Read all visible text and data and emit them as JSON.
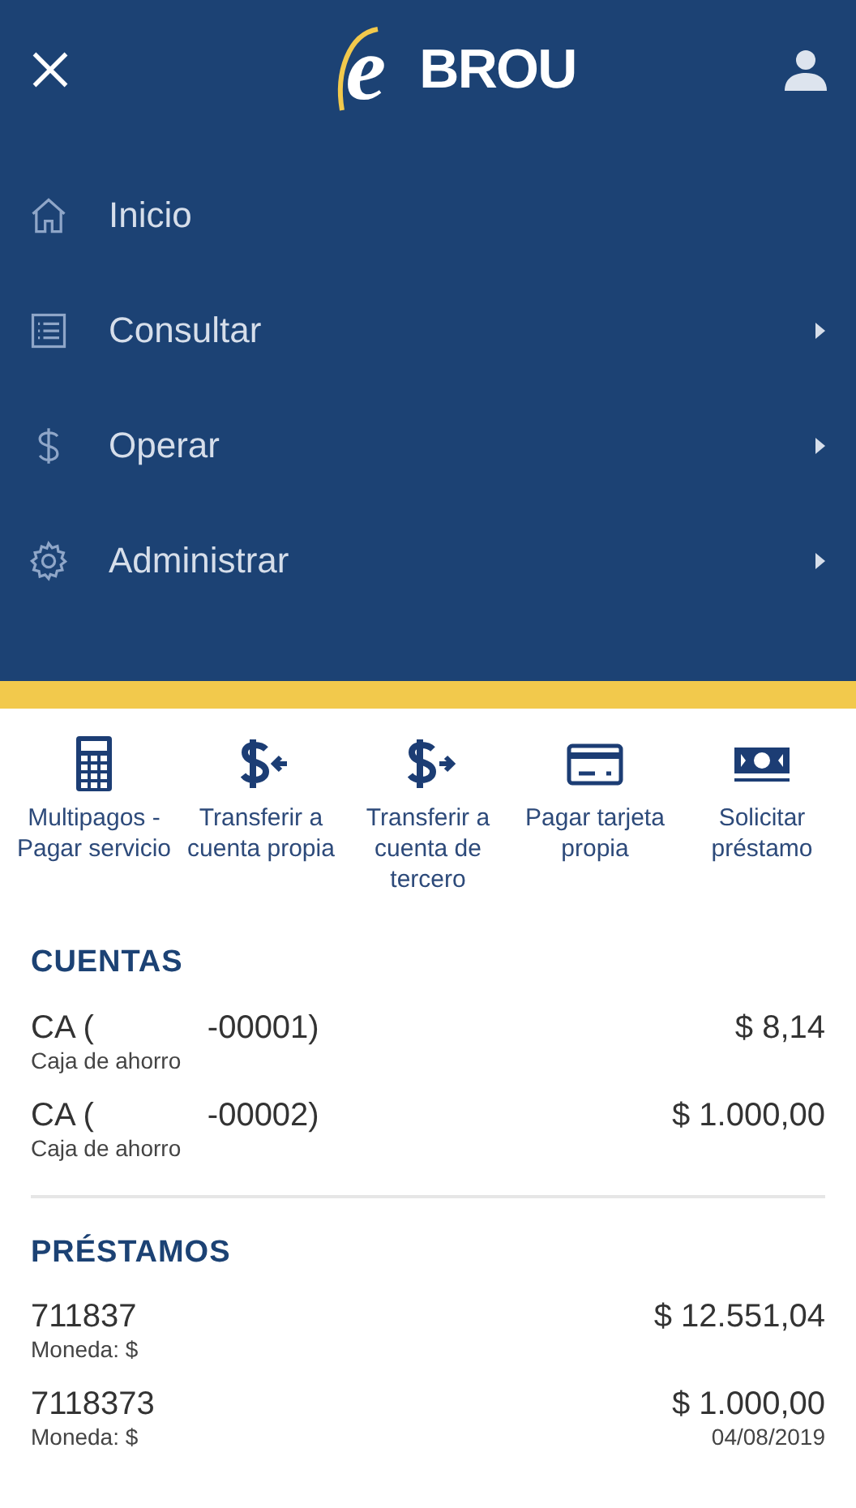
{
  "header": {
    "logo_letter": "e",
    "logo_text": "BROU"
  },
  "menu": [
    {
      "label": "Inicio",
      "has_submenu": false
    },
    {
      "label": "Consultar",
      "has_submenu": true
    },
    {
      "label": "Operar",
      "has_submenu": true
    },
    {
      "label": "Administrar",
      "has_submenu": true
    }
  ],
  "quick_actions": [
    {
      "label": "Multipagos - Pagar servicio"
    },
    {
      "label": "Transferir a cuenta propia"
    },
    {
      "label": "Transferir a cuenta de tercero"
    },
    {
      "label": "Pagar tarjeta propia"
    },
    {
      "label": "Solicitar préstamo"
    }
  ],
  "accounts": {
    "title": "CUENTAS",
    "items": [
      {
        "name_start": "CA (",
        "name_end": "-00001)",
        "type": "Caja de ahorro",
        "balance": "$ 8,14"
      },
      {
        "name_start": "CA (",
        "name_end": "-00002)",
        "type": "Caja de ahorro",
        "balance": "$ 1.000,00"
      }
    ]
  },
  "loans": {
    "title": "PRÉSTAMOS",
    "items": [
      {
        "number": "711837",
        "currency": "Moneda: $",
        "amount": "$ 12.551,04"
      },
      {
        "number": "7118373",
        "currency": "Moneda: $",
        "amount": "$ 1.000,00",
        "date": "04/08/2019"
      }
    ]
  }
}
